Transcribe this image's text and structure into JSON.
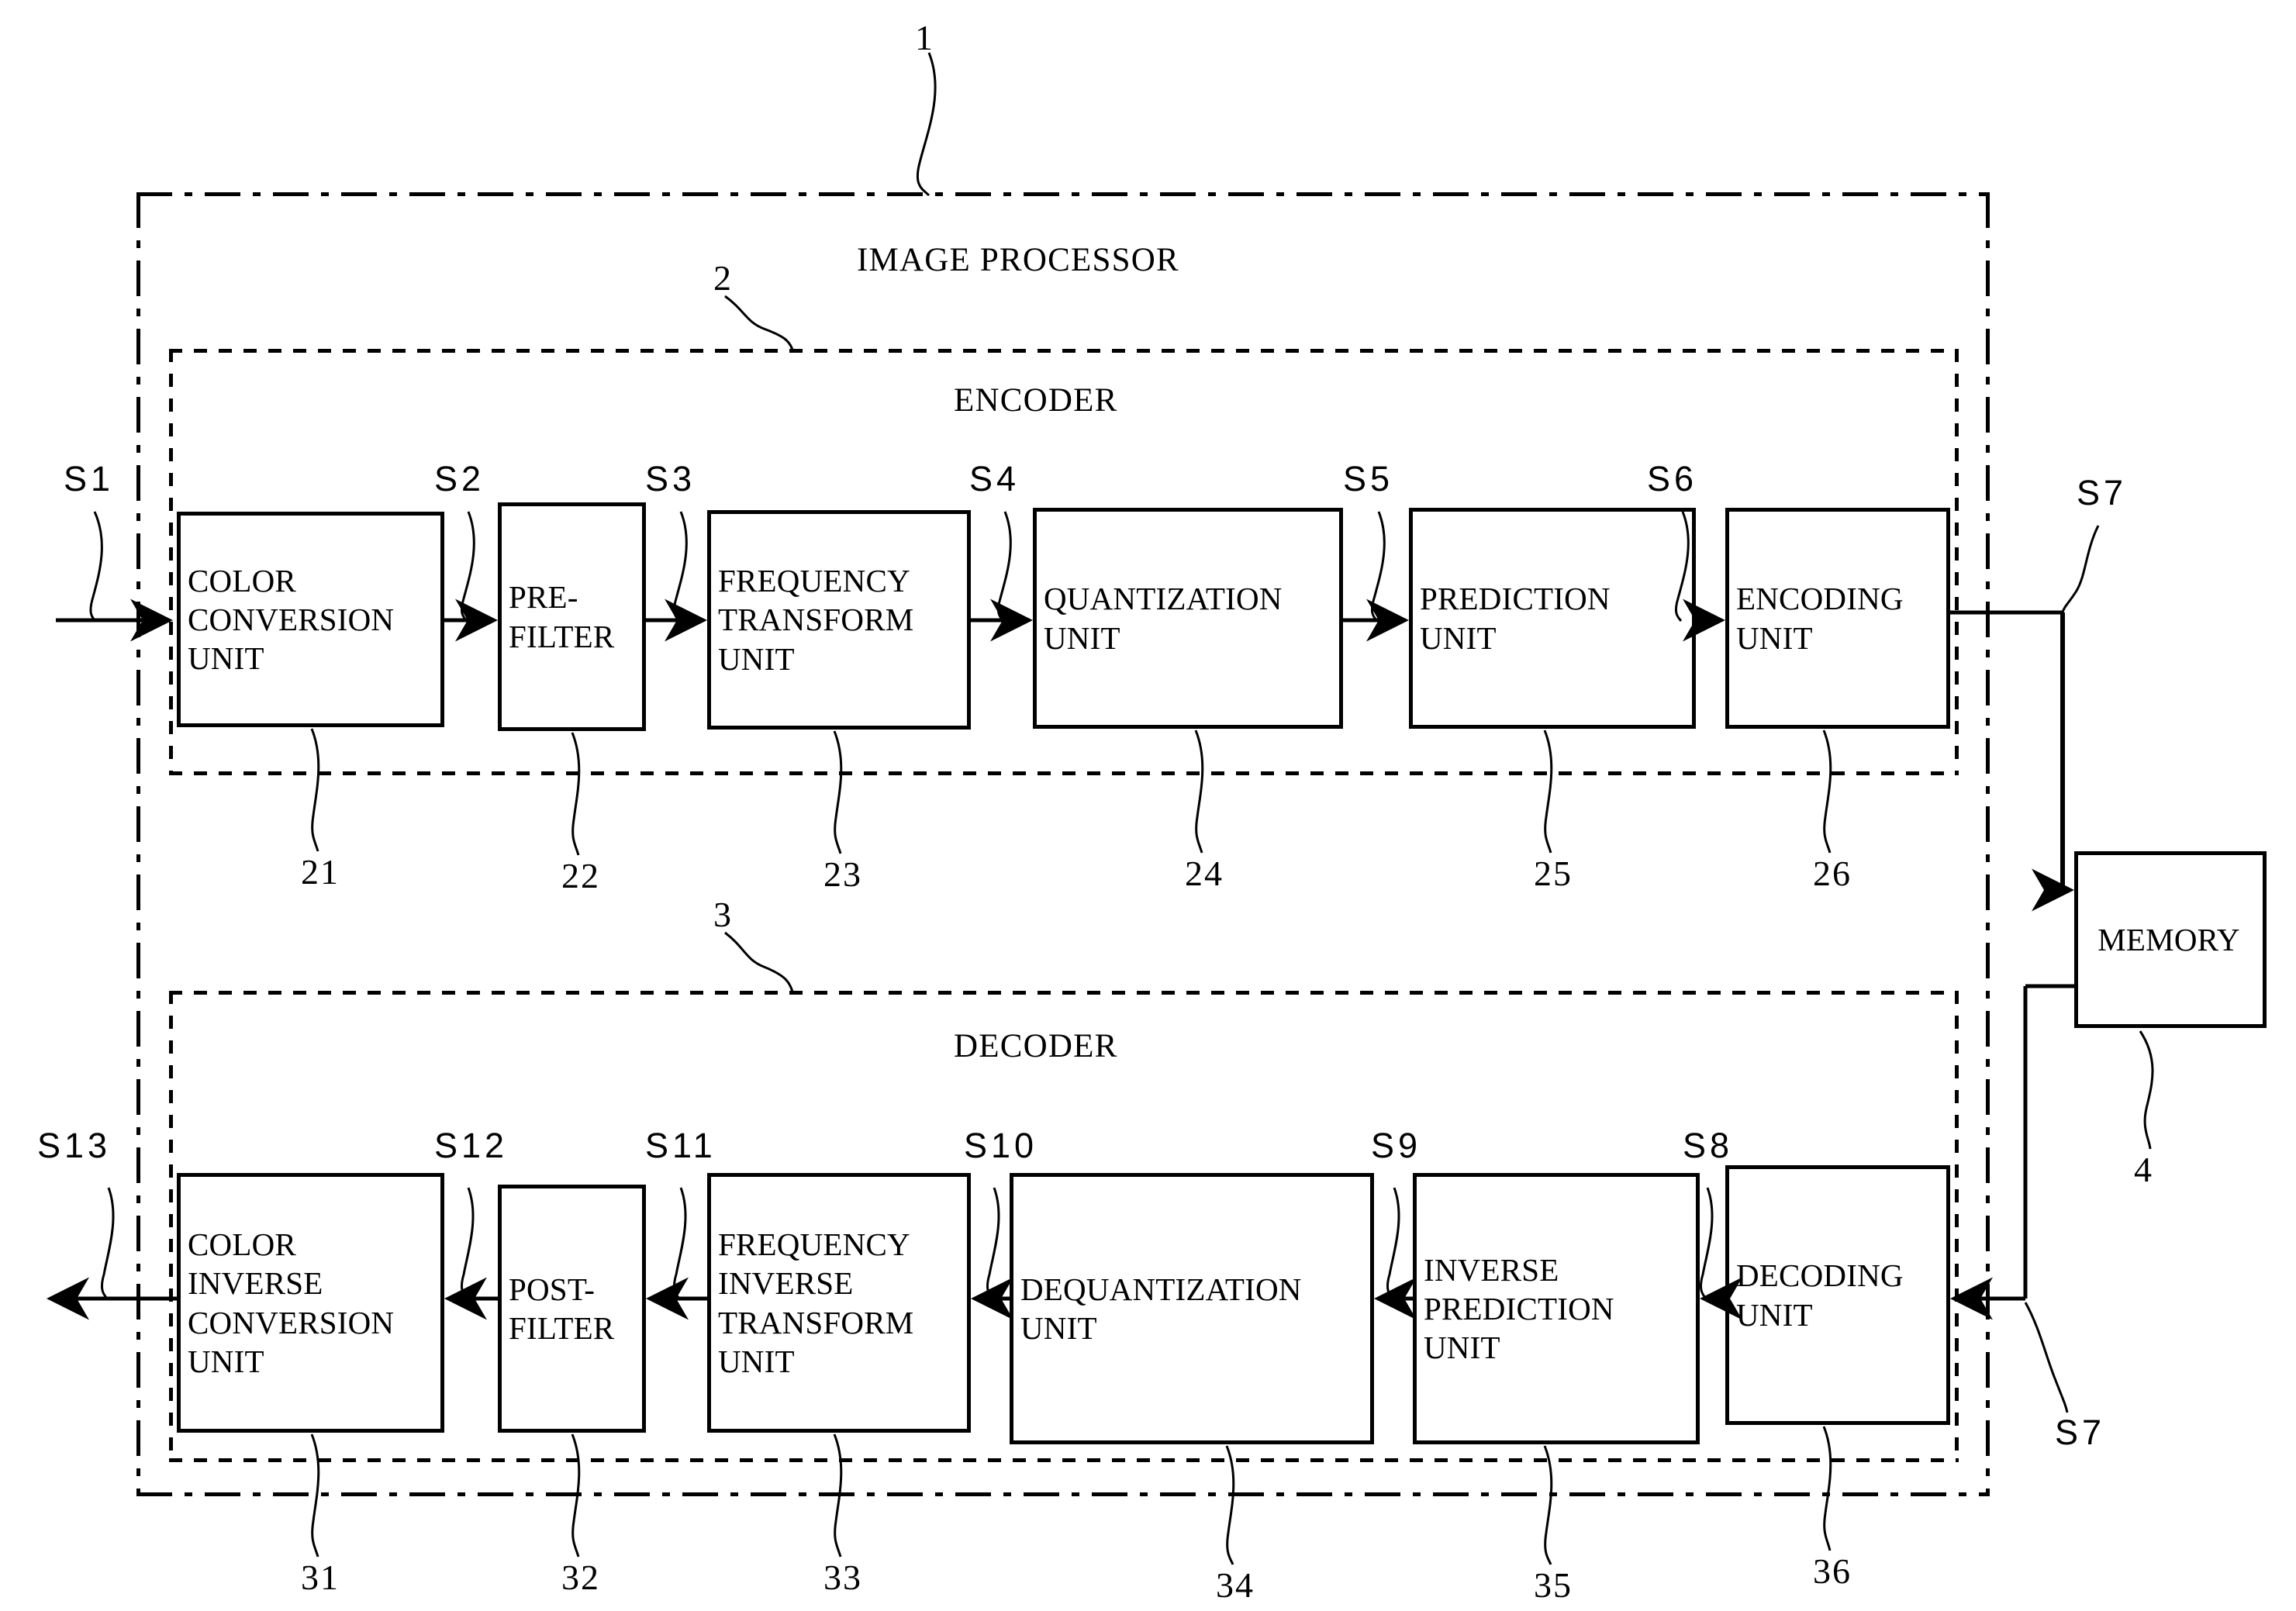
{
  "figure": {
    "title": "IMAGE PROCESSOR",
    "encoder_caption": "ENCODER",
    "decoder_caption": "DECODER",
    "memory_label": "MEMORY"
  },
  "reference_numerals": {
    "processor": "1",
    "encoder": "2",
    "decoder": "3",
    "memory": "4"
  },
  "encoder": {
    "blocks": [
      {
        "label": "COLOR\nCONVERSION\nUNIT",
        "ref": "21"
      },
      {
        "label": "PRE-\nFILTER",
        "ref": "22"
      },
      {
        "label": "FREQUENCY\nTRANSFORM\nUNIT",
        "ref": "23"
      },
      {
        "label": "QUANTIZATION\nUNIT",
        "ref": "24"
      },
      {
        "label": "PREDICTION\nUNIT",
        "ref": "25"
      },
      {
        "label": "ENCODING\nUNIT",
        "ref": "26"
      }
    ],
    "signals": [
      "S1",
      "S2",
      "S3",
      "S4",
      "S5",
      "S6",
      "S7"
    ]
  },
  "decoder": {
    "blocks": [
      {
        "label": "COLOR\nINVERSE\nCONVERSION\nUNIT",
        "ref": "31"
      },
      {
        "label": "POST-\nFILTER",
        "ref": "32"
      },
      {
        "label": "FREQUENCY\nINVERSE\nTRANSFORM\nUNIT",
        "ref": "33"
      },
      {
        "label": "DEQUANTIZATION\nUNIT",
        "ref": "34"
      },
      {
        "label": "INVERSE\nPREDICTION\nUNIT",
        "ref": "35"
      },
      {
        "label": "DECODING\nUNIT",
        "ref": "36"
      }
    ],
    "signals": [
      "S13",
      "S12",
      "S11",
      "S10",
      "S9",
      "S8",
      "S7"
    ]
  },
  "signal_labels": {
    "s1": "S1",
    "s2": "S2",
    "s3": "S3",
    "s4": "S4",
    "s5": "S5",
    "s6": "S6",
    "s7_top": "S7",
    "s7_bottom": "S7",
    "s8": "S8",
    "s9": "S9",
    "s10": "S10",
    "s11": "S11",
    "s12": "S12",
    "s13": "S13"
  },
  "colors": {
    "ink": "#000000",
    "paper": "#ffffff"
  }
}
